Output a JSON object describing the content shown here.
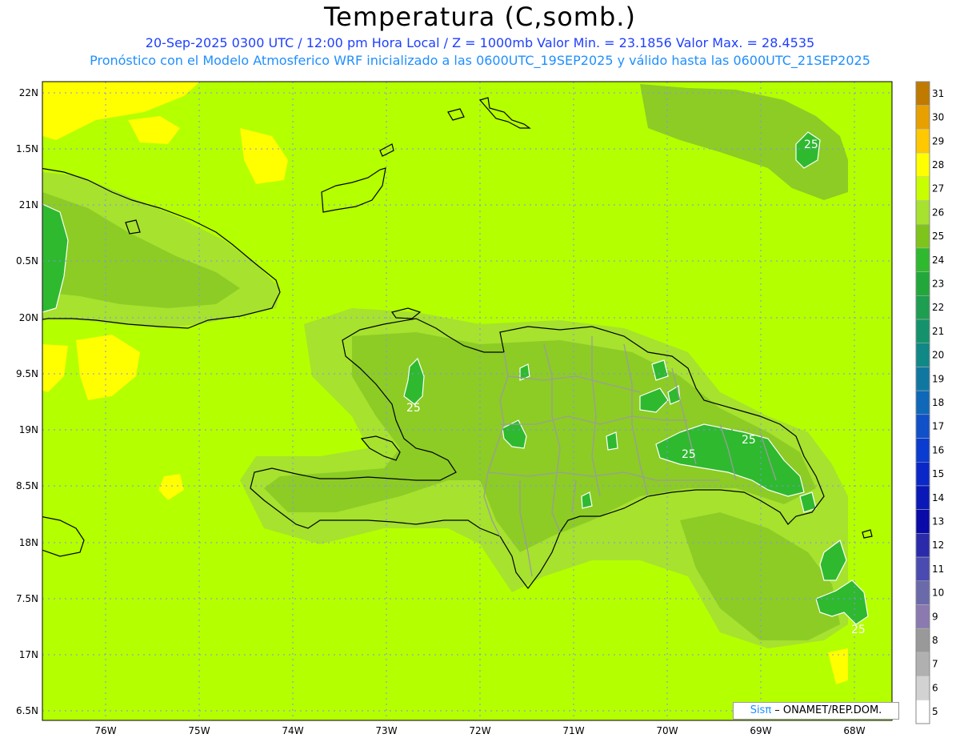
{
  "header": {
    "title": "Temperatura (C,somb.)",
    "subtitle1": "20-Sep-2025 0300 UTC / 12:00 pm Hora Local / Z = 1000mb  Valor Min. = 23.1856  Valor Max. = 28.4535",
    "subtitle2": "Pronóstico con el Modelo Atmosferico WRF inicializado a las 0600UTC_19SEP2025 y válido hasta las  0600UTC_21SEP2025"
  },
  "axes": {
    "lon_labels": [
      "76W",
      "75W",
      "74W",
      "73W",
      "72W",
      "71W",
      "70W",
      "69W",
      "68W"
    ],
    "lat_labels": [
      "22N",
      "1.5N",
      "21N",
      "0.5N",
      "20N",
      "9.5N",
      "19N",
      "8.5N",
      "18N",
      "7.5N",
      "17N",
      "6.5N"
    ]
  },
  "contour_labels": [
    "25",
    "25",
    "25",
    "25",
    "25"
  ],
  "colorbar": {
    "levels": [
      "31",
      "30",
      "29",
      "28",
      "27",
      "26",
      "25",
      "24",
      "23",
      "22",
      "21",
      "20",
      "19",
      "18",
      "17",
      "16",
      "15",
      "14",
      "13",
      "12",
      "11",
      "10",
      "9",
      "8",
      "7",
      "6",
      "5"
    ],
    "colors": [
      "#c07a00",
      "#e8a000",
      "#ffc800",
      "#ffff00",
      "#c8ff00",
      "#a6e22e",
      "#7fc41a",
      "#2fb92f",
      "#22a83a",
      "#1e9e50",
      "#14926b",
      "#108886",
      "#1078a0",
      "#1068b8",
      "#1050c8",
      "#0a3cd0",
      "#0a28c8",
      "#0a18b8",
      "#0a0aa8",
      "#2a2aaa",
      "#4a4ab0",
      "#6a6aaa",
      "#8a7ab0",
      "#999999",
      "#b0b0b0",
      "#d2d2d2",
      "#ffffff"
    ]
  },
  "credit": {
    "sis": "Sisπ",
    "text": " – ONAMET/REP.DOM."
  }
}
